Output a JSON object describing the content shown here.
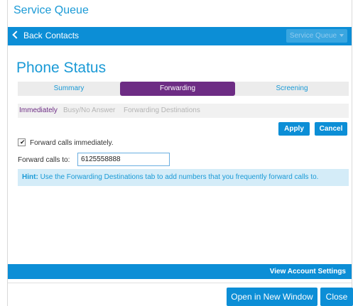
{
  "window": {
    "title": "Service Queue"
  },
  "nav": {
    "back_label": "Back",
    "contacts_label": "Contacts",
    "dropdown_label": "Service Queue"
  },
  "page": {
    "title": "Phone Status"
  },
  "tabs": [
    {
      "label": "Summary"
    },
    {
      "label": "Forwarding"
    },
    {
      "label": "Screening"
    }
  ],
  "subtabs": [
    {
      "label": "Immediately"
    },
    {
      "label": "Busy/No Answer"
    },
    {
      "label": "Forwarding Destinations"
    }
  ],
  "actions": {
    "apply_label": "Apply",
    "cancel_label": "Cancel"
  },
  "form": {
    "forward_checkbox_label": "Forward calls immediately.",
    "forward_checked": true,
    "forward_to_label": "Forward calls to:",
    "forward_to_value": "6125558888"
  },
  "hint": {
    "prefix": "Hint:",
    "text": "Use the Forwarding Destinations tab to add numbers that you frequently forward calls to."
  },
  "footer": {
    "account_settings_label": "View Account Settings",
    "open_new_window_label": "Open in New Window",
    "close_label": "Close"
  },
  "colors": {
    "accent": "#0c8ed6",
    "title_blue": "#1a9ad6",
    "active_tab": "#6d2c84",
    "hint_bg": "#d4ecf8"
  }
}
